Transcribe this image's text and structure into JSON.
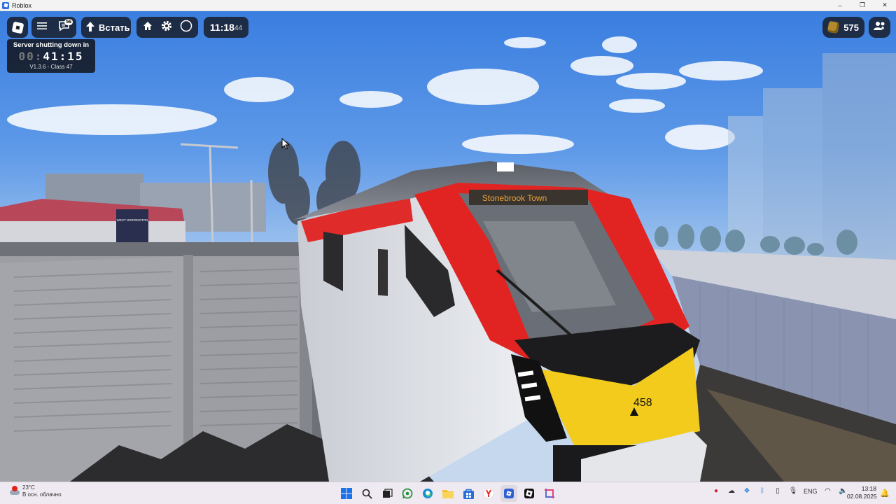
{
  "window": {
    "title": "Roblox",
    "min": "–",
    "max": "❐",
    "close": "✕"
  },
  "hud": {
    "chat_badge": "56",
    "jump_label": "Встать",
    "clock_main": "11:18",
    "clock_sec": "44",
    "coins": "575"
  },
  "shutdown": {
    "label": "Server shutting down in",
    "timer_dim": "00:",
    "timer": "41:15",
    "version": "V1.3.6 - Class 47"
  },
  "scene": {
    "destination_display": "Stonebrook Town",
    "unit_number": "458",
    "station_sign": "WEST NORRINGTON"
  },
  "taskbar": {
    "temperature": "23°C",
    "weather": "В осн. облачно",
    "language": "ENG",
    "time": "13:18",
    "date": "02.08.2025",
    "apps": [
      "windows-start",
      "search",
      "task-view",
      "whatsapp",
      "edge",
      "file-explorer",
      "store",
      "yandex",
      "roblox",
      "roblox-studio",
      "snipping-tool"
    ]
  }
}
